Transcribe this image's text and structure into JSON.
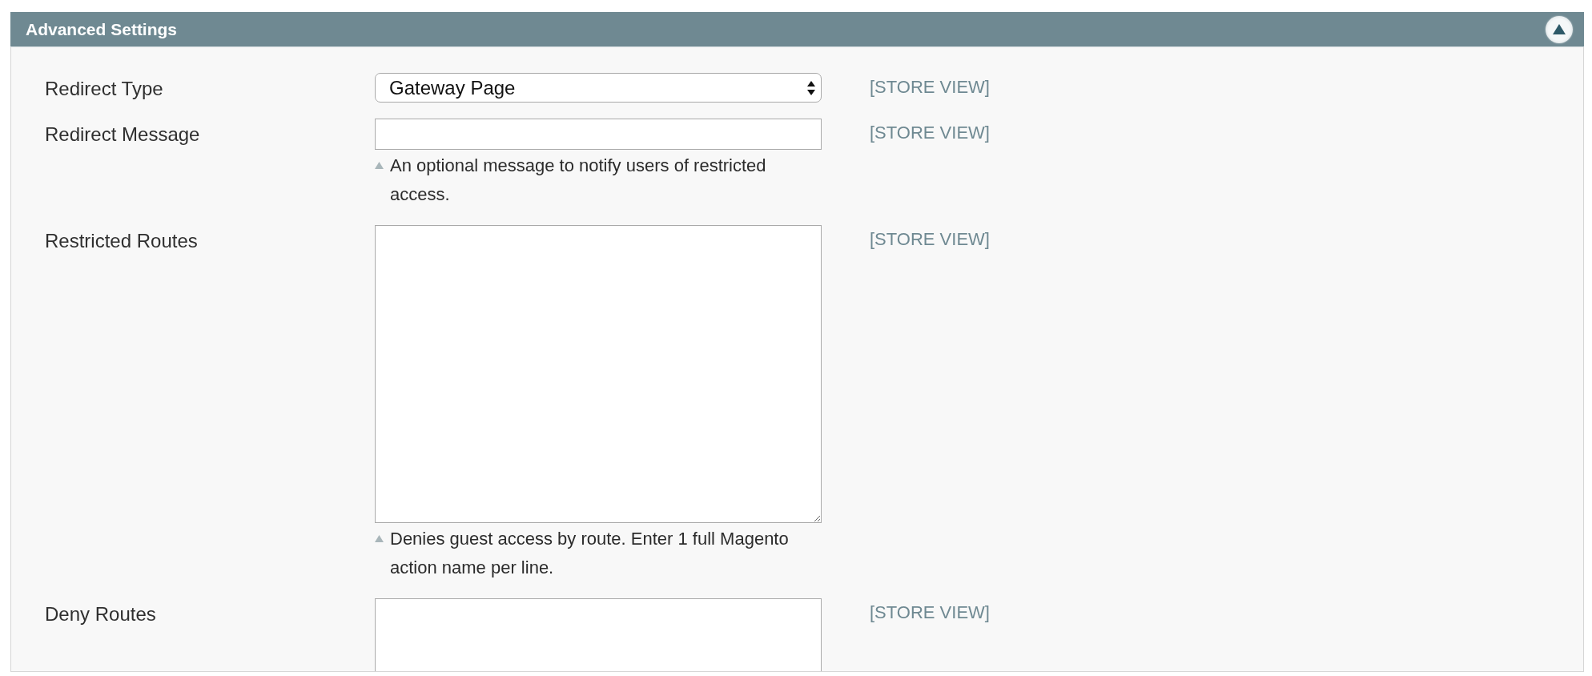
{
  "panel": {
    "title": "Advanced Settings",
    "expanded": true
  },
  "fields": [
    {
      "label": "Redirect Type",
      "kind": "select",
      "value": "Gateway Page",
      "scope": "[STORE VIEW]"
    },
    {
      "label": "Redirect Message",
      "kind": "text",
      "scope": "[STORE VIEW]",
      "note": "An optional message to notify users of restricted access."
    },
    {
      "label": "Restricted Routes",
      "kind": "textarea",
      "scope": "[STORE VIEW]",
      "note": "Denies guest access by route. Enter 1 full Magento action name per line."
    },
    {
      "label": "Deny Routes",
      "kind": "textarea",
      "scope": "[STORE VIEW]"
    }
  ]
}
